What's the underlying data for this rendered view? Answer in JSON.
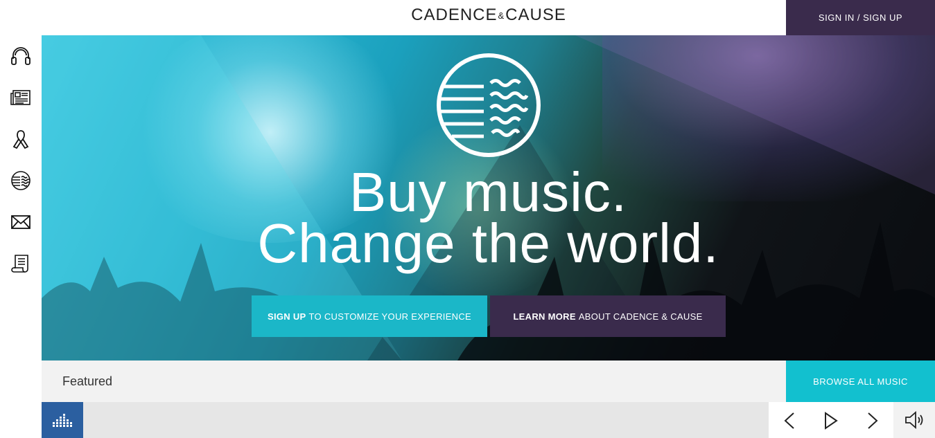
{
  "brand": {
    "left": "CADENCE",
    "amp": "&",
    "right": "CAUSE"
  },
  "header": {
    "signin_label": "SIGN IN / SIGN UP"
  },
  "sidebar": {
    "items": [
      {
        "icon": "headphones-icon"
      },
      {
        "icon": "newspaper-icon"
      },
      {
        "icon": "ribbon-icon"
      },
      {
        "icon": "globe-waves-icon"
      },
      {
        "icon": "envelope-icon"
      },
      {
        "icon": "scroll-icon"
      }
    ]
  },
  "hero": {
    "headline_line1": "Buy music.",
    "headline_line2": "Change the world.",
    "cta_signup_bold": "SIGN UP",
    "cta_signup_rest": "TO CUSTOMIZE YOUR EXPERIENCE",
    "cta_learn_bold": "LEARN MORE",
    "cta_learn_rest": "ABOUT CADENCE & CAUSE"
  },
  "featured": {
    "title": "Featured",
    "browse_label": "BROWSE ALL MUSIC"
  },
  "player": {
    "thumb_icon": "equalizer-icon",
    "controls": [
      "previous-icon",
      "play-icon",
      "next-icon"
    ],
    "volume_icon": "volume-icon"
  },
  "colors": {
    "purple": "#3a2b4c",
    "teal": "#1bb7c8",
    "browse_teal": "#12c0cf",
    "player_blue": "#2b5fa0"
  }
}
